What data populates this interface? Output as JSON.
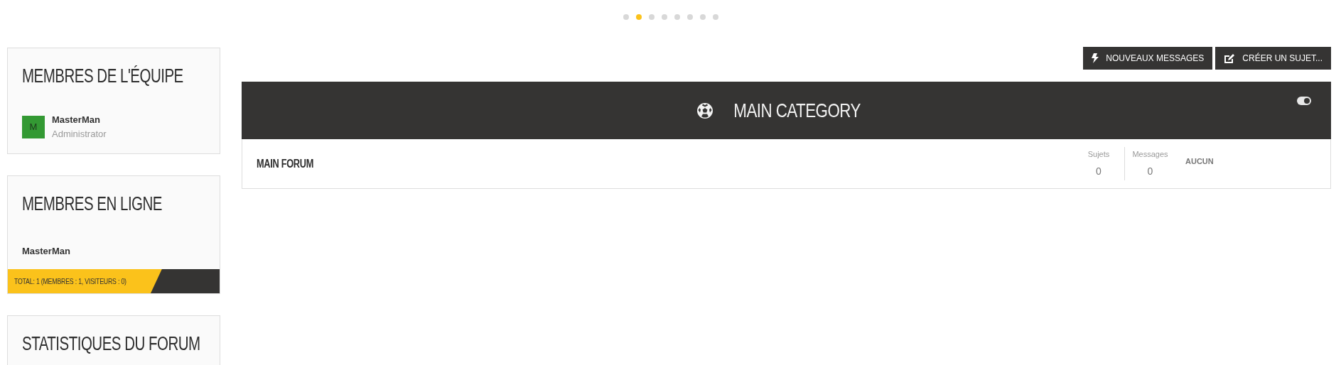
{
  "carousel": {
    "dots": [
      {
        "selected": false
      },
      {
        "selected": true
      },
      {
        "selected": false
      },
      {
        "selected": false
      },
      {
        "selected": false
      },
      {
        "selected": false
      },
      {
        "selected": false
      },
      {
        "selected": false
      }
    ]
  },
  "sidebar": {
    "team": {
      "title": "MEMBRES DE L'ÉQUIPE",
      "members": [
        {
          "initial": "M",
          "name": "MasterMan",
          "role": "Administrator",
          "color": "#339933"
        }
      ]
    },
    "online": {
      "title": "MEMBRES EN LIGNE",
      "members": [
        "MasterMan"
      ],
      "total": "TOTAL: 1 (MEMBRES : 1, VISITEURS : 0)"
    },
    "stats": {
      "title": "STATISTIQUES DU FORUM"
    }
  },
  "toolbar": {
    "buttons": [
      {
        "kind": "bolt",
        "label": "NOUVEAUX MESSAGES"
      },
      {
        "kind": "edit",
        "label": "CRÉER UN SUJET..."
      }
    ]
  },
  "category": {
    "title": "MAIN CATEGORY",
    "toggle": {
      "on": true
    },
    "forums": [
      {
        "name": "MAIN FORUM",
        "stats": [
          {
            "label": "Sujets",
            "value": "0"
          },
          {
            "label": "Messages",
            "value": "0"
          }
        ],
        "last_post": "AUCUN"
      }
    ]
  }
}
